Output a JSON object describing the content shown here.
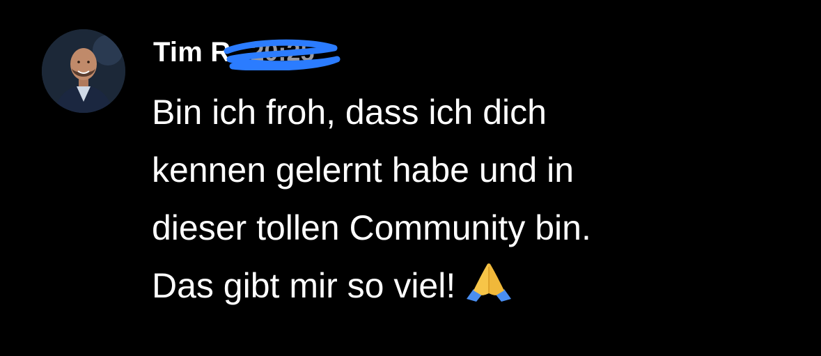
{
  "message": {
    "author_visible": "Tim R",
    "timestamp": "20:25",
    "lines": [
      "Bin ich froh, dass ich dich",
      "kennen gelernt habe und in",
      "dieser tollen Community bin.",
      "Das gibt mir so viel!"
    ],
    "emoji": "folded-hands",
    "avatar": "profile-photo"
  },
  "colors": {
    "background": "#000000",
    "text": "#ffffff",
    "timestamp": "#9a9aa0",
    "redaction": "#2b7cff",
    "emoji_skin": "#f7c548",
    "emoji_sleeve": "#4a8ef0"
  }
}
